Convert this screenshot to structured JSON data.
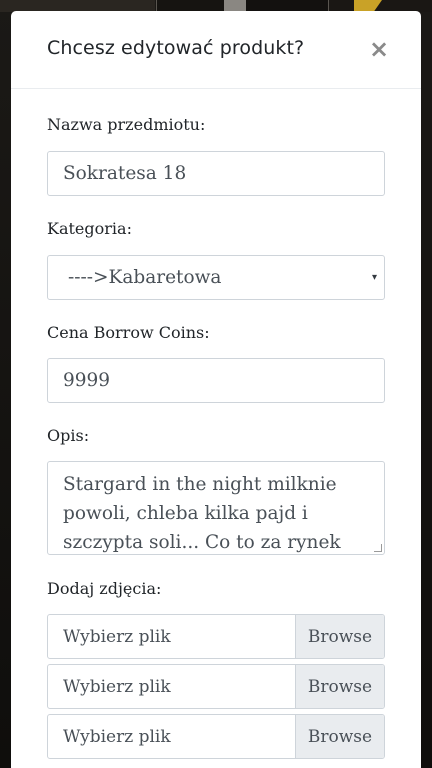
{
  "modal": {
    "title": "Chcesz edytować produkt?",
    "close_symbol": "×"
  },
  "form": {
    "name": {
      "label": "Nazwa przedmiotu:",
      "value": "Sokratesa 18"
    },
    "category": {
      "label": "Kategoria:",
      "value": "---->Kabaretowa",
      "arrow": "▾"
    },
    "price": {
      "label": "Cena Borrow Coins:",
      "value": "9999"
    },
    "description": {
      "label": "Opis:",
      "value": "Stargard in the night milknie powoli, chleba kilka pajd i szczypta soli... Co to za rynek bez"
    },
    "photos": {
      "label": "Dodaj zdjęcia:",
      "files": [
        {
          "placeholder": "Wybierz plik",
          "button": "Browse"
        },
        {
          "placeholder": "Wybierz plik",
          "button": "Browse"
        },
        {
          "placeholder": "Wybierz plik",
          "button": "Browse"
        }
      ]
    }
  },
  "colors": {
    "accent_pencil": "#c9a227",
    "backdrop": "#141210"
  }
}
